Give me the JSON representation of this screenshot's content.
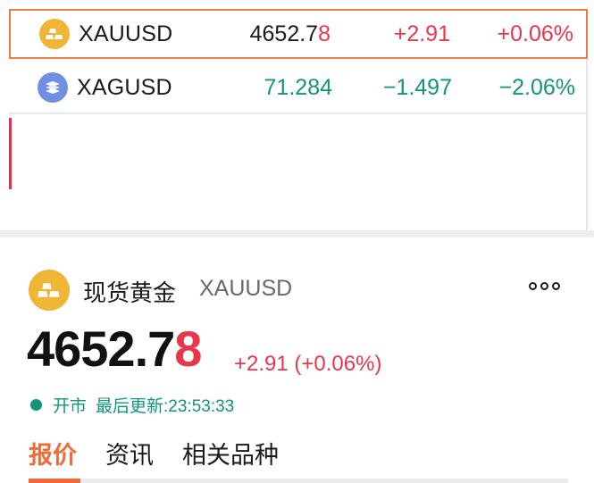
{
  "watchlist": {
    "rows": [
      {
        "symbol": "XAUUSD",
        "price_main": "4652.7",
        "price_last": "8",
        "change": "+2.91",
        "percent": "+0.06%",
        "icon": "gold-bar-icon",
        "selected": true
      },
      {
        "symbol": "XAGUSD",
        "price": "71.284",
        "change": "−1.497",
        "percent": "−2.06%",
        "icon": "silver-bar-icon",
        "selected": false
      }
    ]
  },
  "detail": {
    "name": "现货黄金",
    "symbol": "XAUUSD",
    "price_main": "4652.7",
    "price_last": "8",
    "change_text": "+2.91 (+0.06%)",
    "status": "开市",
    "update_label": "最后更新:23:53:33",
    "tabs": [
      "报价",
      "资讯",
      "相关品种"
    ],
    "active_tab": "报价"
  },
  "colors": {
    "up": "#e8374b",
    "down": "#12957a",
    "accent": "#ee6b3c",
    "gold": "#f0b534",
    "silver": "#6f8fe3"
  }
}
